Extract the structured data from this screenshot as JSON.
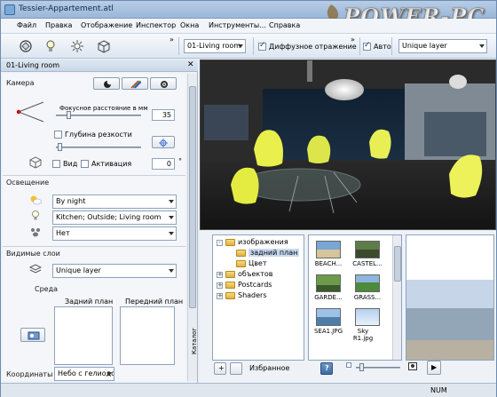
{
  "window": {
    "title": "Tessier-Appartement.atl"
  },
  "watermark": {
    "text": "POWER-PC"
  },
  "menu": {
    "items": [
      "Файл",
      "Правка",
      "Отображение",
      "Инспектор",
      "Окна",
      "Инструменты...",
      "Справка"
    ]
  },
  "toolbar": {
    "overflow": "»",
    "overflow2": "»",
    "view_combo": "01-Living room",
    "diffuse_label": "Диффузное отражение",
    "diffuse_checked": true,
    "auto_label": "Авто",
    "auto_checked": true,
    "layer_combo": "Unique layer"
  },
  "left_panel": {
    "title": "01-Living room",
    "camera_title": "Камера",
    "focal_label": "Фокусное расстояние в мм",
    "focal_value": "35",
    "dof_label": "Глубина резкости",
    "view_label": "Вид",
    "activation_label": "Активация",
    "activation_value": "0",
    "degree_symbol": "°",
    "lighting_title": "Освещение",
    "lighting_combo": "By night",
    "lights_combo": "Kitchen; Outside; Living room",
    "none_combo": "Нет",
    "layers_title": "Видимые слои",
    "layers_combo": "Unique layer",
    "env_title": "Среда",
    "back_label": "Задний план",
    "front_label": "Передний план",
    "sky_combo": "Небо с гелиодо",
    "coords_title": "Координаты"
  },
  "catalog": {
    "tab_label": "Каталог",
    "tree": [
      {
        "label": "изображения",
        "level": 0,
        "expander": "-"
      },
      {
        "label": "задний план",
        "level": 1,
        "selected": true
      },
      {
        "label": "Цвет",
        "level": 1
      },
      {
        "label": "объектов",
        "level": 0,
        "expander": "+"
      },
      {
        "label": "Postcards",
        "level": 0,
        "expander": "+"
      },
      {
        "label": "Shaders",
        "level": 0,
        "expander": "+"
      }
    ],
    "thumbnails": [
      {
        "label": "BEACH..."
      },
      {
        "label": "CASTEL..."
      },
      {
        "label": "GARDE..."
      },
      {
        "label": "GRASS..."
      },
      {
        "label": "SEA1.JPG"
      },
      {
        "label": "Sky R1.jpg"
      }
    ],
    "favorites_label": "Избранное",
    "add_label": "+",
    "help_label": "?",
    "play_label": "▶"
  },
  "status": {
    "num": "NUM"
  }
}
